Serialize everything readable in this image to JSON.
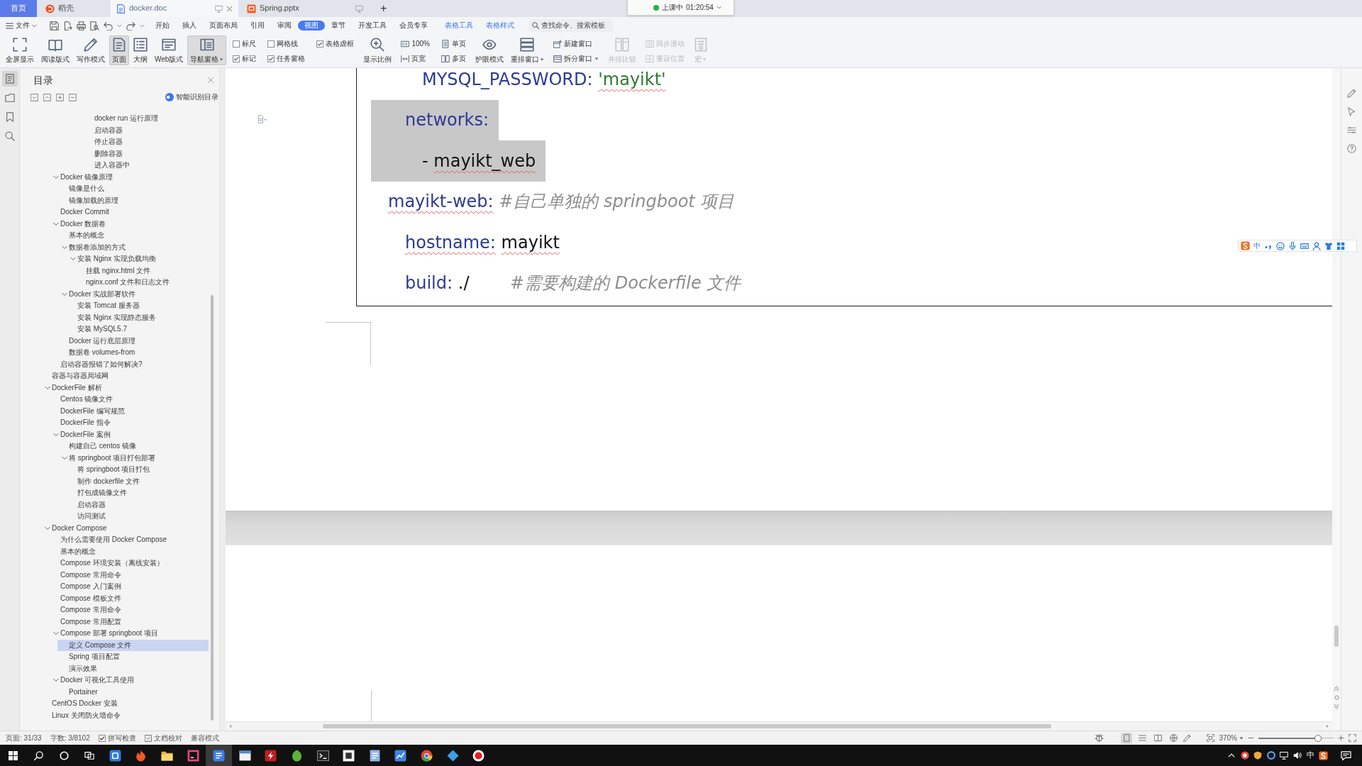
{
  "tab_bar": {
    "home_tab": "首页",
    "tabs": [
      {
        "label": "稻壳",
        "kind": "web",
        "selected": false
      },
      {
        "label": "docker.doc",
        "kind": "writer",
        "selected": true
      },
      {
        "label": "Spring.pptx",
        "kind": "presentation",
        "selected": false
      }
    ],
    "new_tab": "+"
  },
  "recording": {
    "status": "上课中",
    "time": "01:20:54"
  },
  "menu_bar": {
    "file_menu": "文件",
    "tabs": [
      {
        "label": "开始",
        "kind": "main",
        "selected": false
      },
      {
        "label": "插入",
        "kind": "main",
        "selected": false
      },
      {
        "label": "页面布局",
        "kind": "main",
        "selected": false
      },
      {
        "label": "引用",
        "kind": "main",
        "selected": false
      },
      {
        "label": "审阅",
        "kind": "main",
        "selected": false
      },
      {
        "label": "视图",
        "kind": "main",
        "selected": true
      },
      {
        "label": "章节",
        "kind": "main",
        "selected": false
      },
      {
        "label": "开发工具",
        "kind": "main",
        "selected": false
      },
      {
        "label": "会员专享",
        "kind": "main",
        "selected": false
      },
      {
        "label": "表格工具",
        "kind": "contextual",
        "selected": false
      },
      {
        "label": "表格样式",
        "kind": "contextual",
        "selected": false
      }
    ],
    "search": {
      "placeholder": "查找命令、搜索模板"
    }
  },
  "ribbon": [
    {
      "kind": "large",
      "label": "全屏显示",
      "selected": false,
      "disabled": false,
      "dropdown": false
    },
    {
      "kind": "large",
      "label": "阅读版式",
      "selected": false,
      "disabled": false,
      "dropdown": false
    },
    {
      "kind": "large",
      "label": "写作模式",
      "selected": false,
      "disabled": false,
      "dropdown": false
    },
    {
      "kind": "large",
      "label": "页面",
      "selected": true,
      "disabled": false,
      "dropdown": false
    },
    {
      "kind": "large",
      "label": "大纲",
      "selected": false,
      "disabled": false,
      "dropdown": false
    },
    {
      "kind": "large",
      "label": "Web版式",
      "selected": false,
      "disabled": false,
      "dropdown": false
    },
    {
      "kind": "large",
      "label": "导航窗格",
      "selected": true,
      "disabled": false,
      "dropdown": true
    },
    {
      "kind": "stack",
      "items": [
        {
          "kind": "checkbox",
          "label": "标尺",
          "checked": false
        },
        {
          "kind": "checkbox",
          "label": "标记",
          "checked": true
        }
      ]
    },
    {
      "kind": "stack",
      "items": [
        {
          "kind": "checkbox",
          "label": "网格线",
          "checked": false
        },
        {
          "kind": "checkbox",
          "label": "任务窗格",
          "checked": true
        }
      ]
    },
    {
      "kind": "stack",
      "items": [
        {
          "kind": "checkbox",
          "label": "表格虚框",
          "checked": true
        }
      ]
    },
    {
      "kind": "large",
      "label": "显示比例",
      "selected": false,
      "disabled": false,
      "dropdown": false
    },
    {
      "kind": "stack",
      "items": [
        {
          "kind": "button",
          "label": "100%",
          "selected": false,
          "disabled": false,
          "dropdown": false
        },
        {
          "kind": "button",
          "label": "页宽",
          "selected": false,
          "disabled": false,
          "dropdown": false
        }
      ]
    },
    {
      "kind": "stack",
      "items": [
        {
          "kind": "button",
          "label": "单页",
          "selected": false,
          "disabled": false,
          "dropdown": false
        },
        {
          "kind": "button",
          "label": "多页",
          "selected": false,
          "disabled": false,
          "dropdown": false
        }
      ]
    },
    {
      "kind": "large",
      "label": "护眼模式",
      "selected": false,
      "disabled": false,
      "dropdown": false
    },
    {
      "kind": "large",
      "label": "重排窗口",
      "selected": false,
      "disabled": false,
      "dropdown": true
    },
    {
      "kind": "stack",
      "items": [
        {
          "kind": "button",
          "label": "新建窗口",
          "selected": false,
          "disabled": false,
          "dropdown": false
        },
        {
          "kind": "button",
          "label": "拆分窗口",
          "selected": false,
          "disabled": false,
          "dropdown": true
        }
      ]
    },
    {
      "kind": "large",
      "label": "并排比较",
      "selected": false,
      "disabled": true,
      "dropdown": false
    },
    {
      "kind": "stack",
      "items": [
        {
          "kind": "button",
          "label": "同步滚动",
          "selected": false,
          "disabled": true,
          "dropdown": false
        },
        {
          "kind": "button",
          "label": "重设位置",
          "selected": false,
          "disabled": true,
          "dropdown": false
        }
      ]
    },
    {
      "kind": "large",
      "label": "宏",
      "selected": false,
      "disabled": true,
      "dropdown": true
    }
  ],
  "side_tabs": [
    {
      "selected": true
    },
    {
      "selected": false
    },
    {
      "selected": false
    },
    {
      "selected": false
    }
  ],
  "navigation_pane": {
    "title": "目录",
    "smart_toc": "智能识别目录",
    "outline": [
      {
        "children": [
          {
            "children": [
              {
                "children": [
                  {
                    "children": [
                      {
                        "children": [
                          {
                            "label": "docker run 运行原理",
                            "selected": false
                          },
                          {
                            "label": "启动容器",
                            "selected": false
                          },
                          {
                            "label": "停止容器",
                            "selected": false
                          },
                          {
                            "label": "删除容器",
                            "selected": false
                          },
                          {
                            "label": "进入容器中",
                            "selected": false
                          }
                        ]
                      }
                    ]
                  }
                ]
              }
            ]
          },
          {
            "label": "Docker 镜像原理",
            "selected": false,
            "expanded": true,
            "children": [
              {
                "label": "镜像是什么",
                "selected": false
              },
              {
                "label": "镜像加载的原理",
                "selected": false
              }
            ]
          },
          {
            "label": "Docker Commit",
            "selected": false
          },
          {
            "label": "Docker 数据卷",
            "selected": false,
            "expanded": true,
            "children": [
              {
                "label": "基本的概念",
                "selected": false
              },
              {
                "label": "数据卷添加的方式",
                "selected": false,
                "expanded": true,
                "children": [
                  {
                    "label": "安装 Nginx 实现负载均衡",
                    "selected": false,
                    "expanded": true,
                    "children": [
                      {
                        "label": "挂载 nginx.html 文件",
                        "selected": false
                      },
                      {
                        "label": "nginx.conf 文件和日志文件",
                        "selected": false
                      }
                    ]
                  }
                ]
              },
              {
                "label": "Docker 实战部署软件",
                "selected": false,
                "expanded": true,
                "children": [
                  {
                    "label": "安装 Tomcat 服务器",
                    "selected": false
                  },
                  {
                    "label": "安装 Nginx 实现静态服务",
                    "selected": false
                  },
                  {
                    "label": "安装 MySQL5.7",
                    "selected": false
                  }
                ]
              },
              {
                "label": "Docker 运行底层原理",
                "selected": false
              },
              {
                "label": "数据卷 volumes-from",
                "selected": false
              }
            ]
          },
          {
            "label": "启动容器报错了如何解决?",
            "selected": false
          }
        ]
      },
      {
        "label": "容器与容器局域网",
        "selected": false
      },
      {
        "label": "DockerFile 解析",
        "selected": false,
        "expanded": true,
        "children": [
          {
            "label": "Centos 镜像文件",
            "selected": false
          },
          {
            "label": "DockerFile 编写规范",
            "selected": false
          },
          {
            "label": "DockerFile 指令",
            "selected": false
          },
          {
            "label": "DockerFile 案例",
            "selected": false,
            "expanded": true,
            "children": [
              {
                "label": "构建自己 centos 镜像",
                "selected": false
              },
              {
                "label": "将 springboot 项目打包部署",
                "selected": false,
                "expanded": true,
                "children": [
                  {
                    "label": "将 springboot 项目打包",
                    "selected": false
                  },
                  {
                    "label": "制作 dockerfile 文件",
                    "selected": false
                  },
                  {
                    "label": "打包成镜像文件",
                    "selected": false
                  },
                  {
                    "label": "启动容器",
                    "selected": false
                  },
                  {
                    "label": "访问测试",
                    "selected": false
                  }
                ]
              }
            ]
          }
        ]
      },
      {
        "label": "Docker Compose",
        "selected": false,
        "expanded": true,
        "children": [
          {
            "label": "为什么需要使用 Docker Compose",
            "selected": false
          },
          {
            "label": "基本的概念",
            "selected": false
          },
          {
            "label": "Compose 环境安装（离线安装）",
            "selected": false
          },
          {
            "label": "Compose 常用命令",
            "selected": false
          },
          {
            "label": "Compose 入门案例",
            "selected": false
          },
          {
            "label": "Compose 模板文件",
            "selected": false
          },
          {
            "label": "Compose 常用命令",
            "selected": false
          },
          {
            "label": "Compose 常用配置",
            "selected": false
          },
          {
            "label": "Compose 部署 springboot 项目",
            "selected": false,
            "expanded": true,
            "children": [
              {
                "label": "定义 Compose 文件",
                "selected": true
              },
              {
                "label": "Spring 项目配置",
                "selected": false
              },
              {
                "label": "演示效果",
                "selected": false
              }
            ]
          },
          {
            "label": "Docker 可视化工具使用",
            "selected": false,
            "expanded": true,
            "children": [
              {
                "label": "Portainer",
                "selected": false
              }
            ]
          }
        ]
      },
      {
        "label": "CentOS Docker 安装",
        "selected": false
      },
      {
        "label": "Linux 关闭防火墙命令",
        "selected": false
      }
    ]
  },
  "document": {
    "code": [
      {
        "children": [
          {
            "children": [
              {
                "tokens": [
                  {
                    "kind": "key",
                    "text": "MYSQL_PASSWORD:",
                    "spell_error": false
                  },
                  {
                    "kind": "string",
                    "text": "'mayikt'",
                    "spell_error": true
                  }
                ],
                "selected": false
              }
            ]
          },
          {
            "tokens": [
              {
                "kind": "key",
                "text": "networks:",
                "spell_error": false
              }
            ],
            "selected": true,
            "children": [
              {
                "tokens": [
                  {
                    "kind": "value",
                    "text": "-",
                    "spell_error": false
                  },
                  {
                    "kind": "value",
                    "text": "mayikt_web",
                    "spell_error": true
                  }
                ],
                "selected": true
              }
            ]
          }
        ]
      },
      {
        "tokens": [
          {
            "kind": "key",
            "text": "mayikt-web:",
            "spell_error": true
          },
          {
            "kind": "comment",
            "text": "#自己单独的 springboot 项目",
            "spell_error": false
          }
        ],
        "selected": false,
        "children": [
          {
            "tokens": [
              {
                "kind": "key",
                "text": "hostname:",
                "spell_error": true
              },
              {
                "kind": "value",
                "text": "mayikt",
                "spell_error": true
              }
            ],
            "selected": false
          },
          {
            "tokens": [
              {
                "kind": "key",
                "text": "build:",
                "spell_error": false
              },
              {
                "kind": "value",
                "text": "./",
                "spell_error": false
              },
              {
                "kind": "comment",
                "text": "#需要构建的 Dockerfile 文件",
                "spell_error": false
              }
            ],
            "selected": false
          }
        ]
      }
    ]
  },
  "ime_toolbar": {
    "mode": "中"
  },
  "status_bar": {
    "page": "页面: 31/33",
    "words": "字数: 3/8102",
    "spell_check": {
      "label": "拼写检查",
      "checked": true
    },
    "proofread": "文档校对",
    "compat_mode": "兼容模式",
    "views": [
      {
        "selected": true
      },
      {
        "selected": false
      },
      {
        "selected": false
      },
      {
        "selected": false
      }
    ],
    "zoom": "370%",
    "zoom_slider": {
      "level": 0.79
    }
  },
  "taskbar": {
    "apps": [
      {
        "active": false
      },
      {
        "active": false
      },
      {
        "active": false
      },
      {
        "active": false
      },
      {
        "active": true
      },
      {
        "active": false
      },
      {
        "active": false
      },
      {
        "active": false
      },
      {
        "active": false
      },
      {
        "active": false
      },
      {
        "active": false
      },
      {
        "active": false
      },
      {
        "active": false
      },
      {
        "active": false
      },
      {
        "active": false
      }
    ],
    "input_mode": "中"
  }
}
